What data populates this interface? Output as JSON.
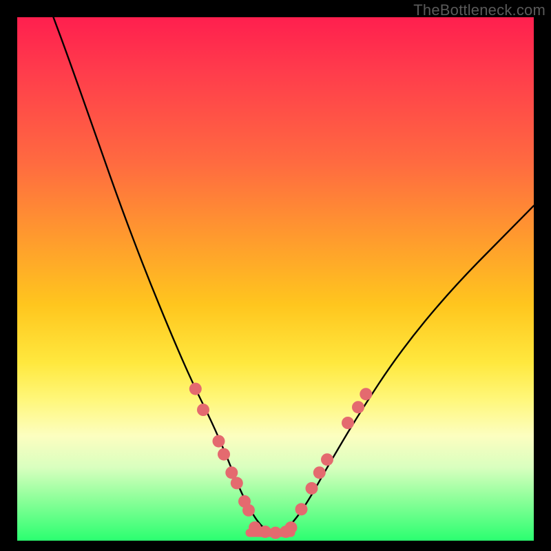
{
  "watermark": "TheBottleneck.com",
  "colors": {
    "curve": "#000000",
    "dot_fill": "#e46a6f",
    "dot_stroke": "#d84e55"
  },
  "chart_data": {
    "type": "line",
    "title": "",
    "xlabel": "",
    "ylabel": "",
    "xlim": [
      0,
      100
    ],
    "ylim": [
      0,
      100
    ],
    "grid": false,
    "legend": false,
    "series": [
      {
        "name": "bottleneck-curve",
        "x": [
          7,
          10,
          15,
          20,
          25,
          30,
          34,
          38,
          41,
          43,
          45,
          47,
          49,
          51,
          53,
          56,
          60,
          66,
          74,
          84,
          96,
          100
        ],
        "y": [
          100,
          92,
          78,
          64,
          51,
          39,
          30,
          22,
          15,
          10,
          6,
          3,
          1.5,
          1.5,
          3,
          7,
          14,
          24,
          36,
          48,
          60,
          64
        ]
      }
    ],
    "annotations": {
      "flat_bottom": {
        "x_range": [
          45,
          53
        ],
        "y": 1.5
      },
      "dot_clusters": [
        {
          "side": "left",
          "x": 34.5,
          "y": 29
        },
        {
          "side": "left",
          "x": 36.0,
          "y": 25
        },
        {
          "side": "left",
          "x": 39.0,
          "y": 19
        },
        {
          "side": "left",
          "x": 40.0,
          "y": 16.5
        },
        {
          "side": "left",
          "x": 41.5,
          "y": 13
        },
        {
          "side": "left",
          "x": 42.5,
          "y": 11
        },
        {
          "side": "left",
          "x": 44.0,
          "y": 7.5
        },
        {
          "side": "left",
          "x": 44.8,
          "y": 5.8
        },
        {
          "side": "bottom",
          "x": 46.0,
          "y": 2.5
        },
        {
          "side": "bottom",
          "x": 48.0,
          "y": 1.7
        },
        {
          "side": "bottom",
          "x": 50.0,
          "y": 1.5
        },
        {
          "side": "bottom",
          "x": 52.0,
          "y": 1.7
        },
        {
          "side": "bottom",
          "x": 53.0,
          "y": 2.5
        },
        {
          "side": "right",
          "x": 55.0,
          "y": 6.0
        },
        {
          "side": "right",
          "x": 57.0,
          "y": 10.0
        },
        {
          "side": "right",
          "x": 58.5,
          "y": 13.0
        },
        {
          "side": "right",
          "x": 60.0,
          "y": 15.5
        },
        {
          "side": "right",
          "x": 64.0,
          "y": 22.5
        },
        {
          "side": "right",
          "x": 66.0,
          "y": 25.5
        },
        {
          "side": "right",
          "x": 67.5,
          "y": 28.0
        }
      ]
    }
  }
}
